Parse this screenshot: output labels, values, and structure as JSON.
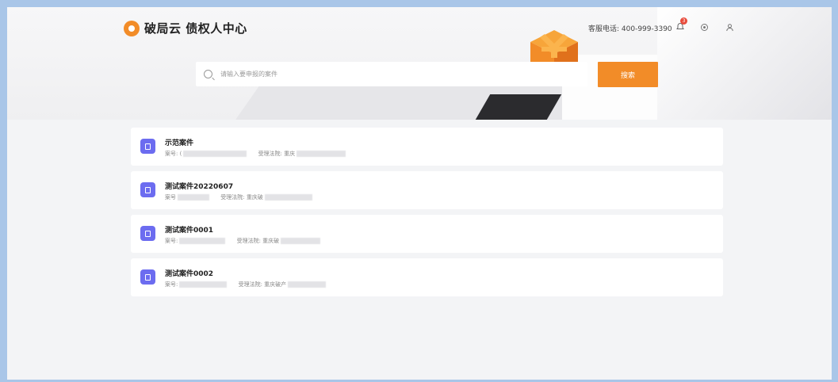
{
  "header": {
    "logo_text": "破局云 债权人中心",
    "hotline": "客服电话: 400-999-3390",
    "notification_count": "3"
  },
  "search": {
    "placeholder": "请输入要申报的案件",
    "button_label": "搜索"
  },
  "cases": [
    {
      "title": "示范案件",
      "case_no_label": "案号: (",
      "court_label": "受理法院: 重庆"
    },
    {
      "title": "测试案件20220607",
      "case_no_label": "案号",
      "court_label": "受理法院: 重庆破"
    },
    {
      "title": "测试案件0001",
      "case_no_label": "案号:",
      "court_label": "受理法院: 重庆破"
    },
    {
      "title": "测试案件0002",
      "case_no_label": "案号:",
      "court_label": "受理法院: 重庆破产"
    }
  ],
  "colors": {
    "accent": "#f28c28",
    "case_icon": "#6c6cf0",
    "badge": "#e84b3c"
  }
}
